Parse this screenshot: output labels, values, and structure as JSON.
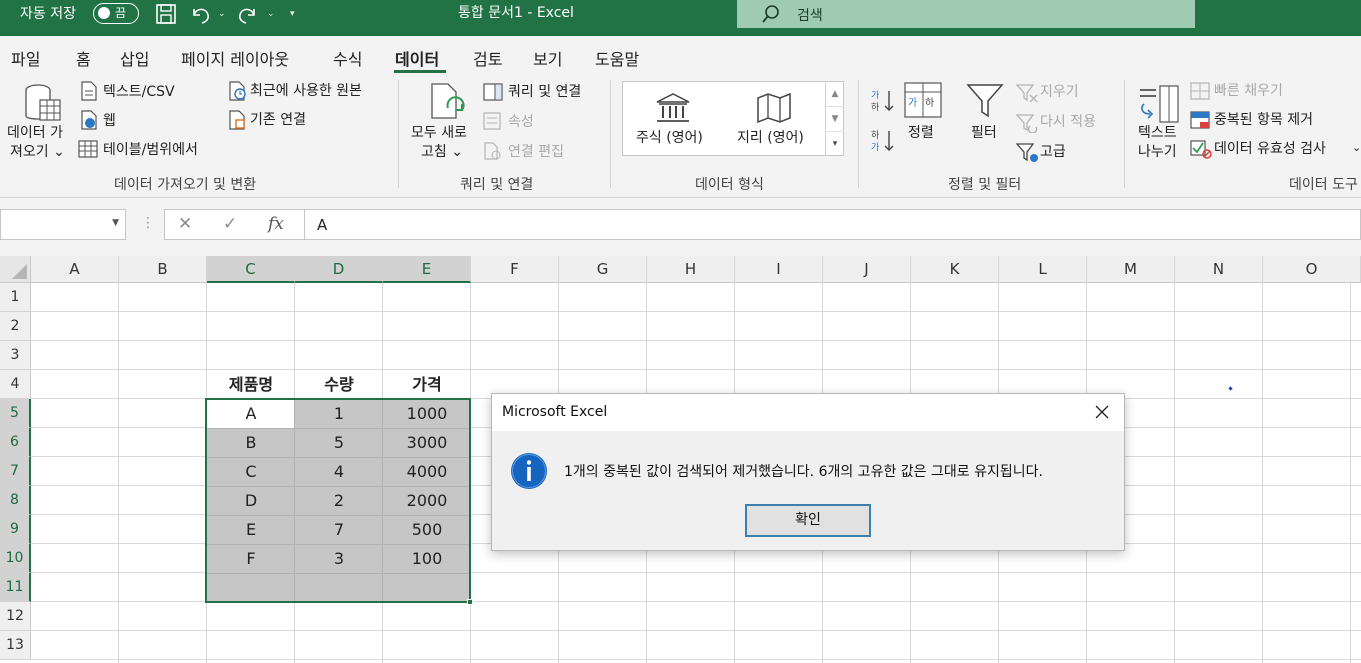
{
  "titlebar": {
    "autosave_label": "자동 저장",
    "toggle_state": "끔",
    "doc_title": "통합 문서1  -  Excel",
    "search_placeholder": "검색",
    "bg_color": "#217346"
  },
  "tabs": [
    "파일",
    "홈",
    "삽입",
    "페이지 레이아웃",
    "수식",
    "데이터",
    "검토",
    "보기",
    "도움말"
  ],
  "active_tab": "데이터",
  "ribbon": {
    "get_data": {
      "line1": "데이터 가",
      "line2": "져오기 ⌄"
    },
    "text_csv": "텍스트/CSV",
    "web": "웹",
    "table_range": "테이블/범위에서",
    "recent_sources": "최근에 사용한 원본",
    "existing_conn": "기존 연결",
    "group_get_transform": "데이터 가져오기 및 변환",
    "refresh_all": {
      "line1": "모두 새로",
      "line2": "고침 ⌄"
    },
    "queries_conn": "쿼리 및 연결",
    "properties": "속성",
    "edit_links": "연결 편집",
    "group_queries": "쿼리 및 연결",
    "stocks": "주식 (영어)",
    "geography": "지리 (영어)",
    "group_data_types": "데이터 형식",
    "sort": "정렬",
    "filter": "필터",
    "clear": "지우기",
    "reapply": "다시 적용",
    "advanced": "고급",
    "group_sort_filter": "정렬 및 필터",
    "text_to_cols": {
      "line1": "텍스트",
      "line2": "나누기"
    },
    "flash_fill": "빠른 채우기",
    "remove_dups": "중복된 항목 제거",
    "data_validation": "데이터 유효성 검사",
    "group_data_tools": "데이터 도구"
  },
  "formula_bar": {
    "name_box": "",
    "value": "A",
    "fx": "fx"
  },
  "sheet": {
    "columns": [
      "A",
      "B",
      "C",
      "D",
      "E",
      "F",
      "G",
      "H",
      "I",
      "J",
      "K",
      "L",
      "M",
      "N",
      "O"
    ],
    "rows": [
      "1",
      "2",
      "3",
      "4",
      "5",
      "6",
      "7",
      "8",
      "9",
      "10",
      "11",
      "12",
      "13"
    ],
    "header_row": [
      "제품명",
      "수량",
      "가격"
    ],
    "data_rows": [
      [
        "A",
        "1",
        "1000"
      ],
      [
        "B",
        "5",
        "3000"
      ],
      [
        "C",
        "4",
        "4000"
      ],
      [
        "D",
        "2",
        "2000"
      ],
      [
        "E",
        "7",
        "500"
      ],
      [
        "F",
        "3",
        "100"
      ]
    ]
  },
  "dialog": {
    "title": "Microsoft Excel",
    "message": "1개의 중복된 값이 검색되어 제거했습니다. 6개의 고유한 값은 그대로 유지됩니다.",
    "ok_label": "확인"
  }
}
